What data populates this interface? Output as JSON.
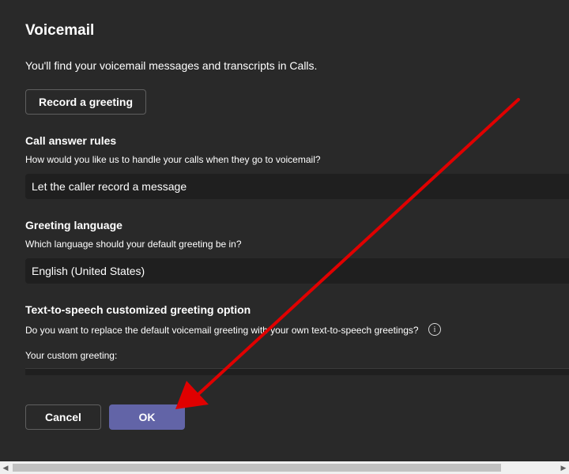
{
  "dialog": {
    "title": "Voicemail",
    "intro": "You'll find your voicemail messages and transcripts in Calls.",
    "record_button": "Record a greeting"
  },
  "call_answer_rules": {
    "title": "Call answer rules",
    "description": "How would you like us to handle your calls when they go to voicemail?",
    "selected": "Let the caller record a message"
  },
  "greeting_language": {
    "title": "Greeting language",
    "description": "Which language should your default greeting be in?",
    "selected": "English (United States)"
  },
  "tts": {
    "title": "Text-to-speech customized greeting option",
    "description": "Do you want to replace the default voicemail greeting with your own text-to-speech greetings?",
    "info_glyph": "i",
    "custom_label": "Your custom greeting:"
  },
  "footer": {
    "cancel_label": "Cancel",
    "ok_label": "OK"
  },
  "icons": {
    "info": "info-icon",
    "scroll_left": "scroll-left-arrow-icon",
    "scroll_right": "scroll-right-arrow-icon",
    "annotation": "red-arrow-annotation-icon"
  },
  "colors": {
    "background": "#292929",
    "field": "#1f1f1f",
    "primary_button": "#6264a7",
    "annotation_arrow": "#e00000"
  }
}
